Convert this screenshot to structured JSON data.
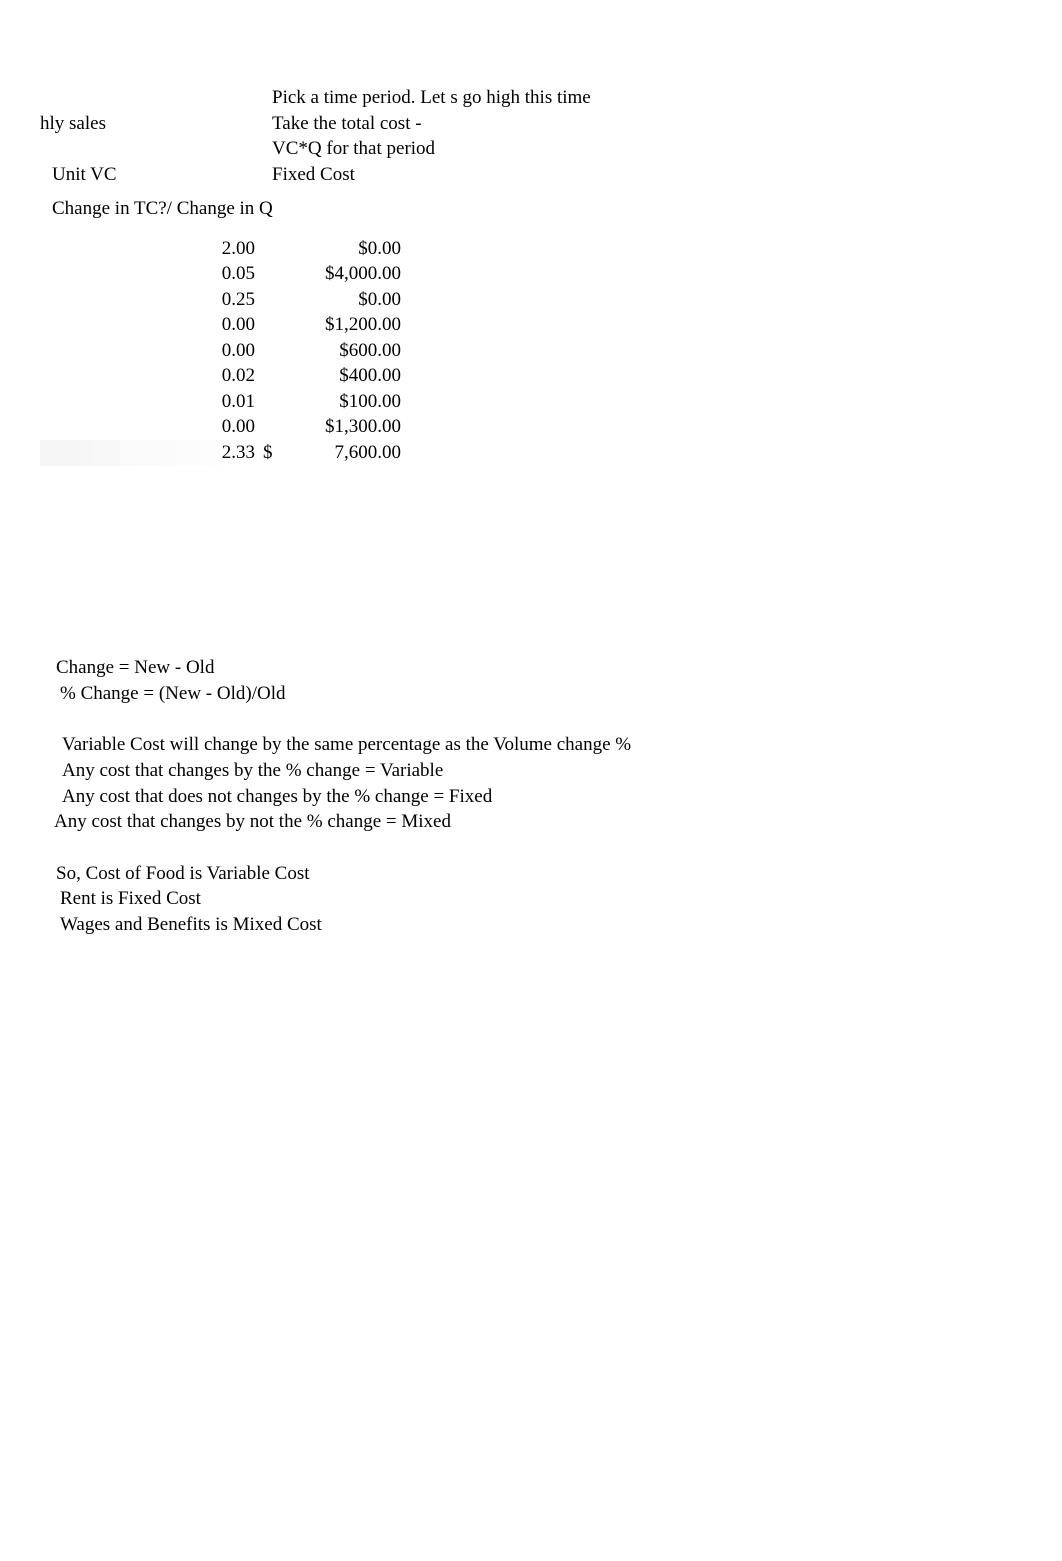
{
  "top": {
    "r0": {
      "left": "",
      "right": "Pick a time period. Let s go high this time"
    },
    "r1": {
      "left": "hly sales",
      "right": "Take the total cost -"
    },
    "r2": {
      "left": "",
      "right": "VC*Q for that period"
    },
    "r3": {
      "left": "Unit VC",
      "right": "Fixed Cost"
    },
    "r4": "Change in TC?/ Change in Q"
  },
  "table": {
    "rows": [
      {
        "a": "2.00",
        "b": "",
        "c": "$0.00"
      },
      {
        "a": "0.05",
        "b": "",
        "c": "$4,000.00"
      },
      {
        "a": "0.25",
        "b": "",
        "c": "$0.00"
      },
      {
        "a": "0.00",
        "b": "",
        "c": "$1,200.00"
      },
      {
        "a": "0.00",
        "b": "",
        "c": "$600.00"
      },
      {
        "a": "0.02",
        "b": "",
        "c": "$400.00"
      },
      {
        "a": "0.01",
        "b": "",
        "c": "$100.00"
      },
      {
        "a": "0.00",
        "b": "",
        "c": "$1,300.00"
      },
      {
        "a": "2.33",
        "b": "$",
        "c": "7,600.00"
      }
    ]
  },
  "notes": {
    "l1": "Change = New - Old",
    "l2": "% Change = (New - Old)/Old",
    "l3": "Variable Cost will change by the same percentage as the Volume change %",
    "l4": "Any cost that changes by the % change = Variable",
    "l5": "Any cost that does not changes by the % change = Fixed",
    "l6": "Any cost that  changes by not the % change = Mixed",
    "l7": "So, Cost of Food is Variable Cost",
    "l8": "Rent is Fixed Cost",
    "l9": "Wages and Benefits is Mixed Cost"
  }
}
